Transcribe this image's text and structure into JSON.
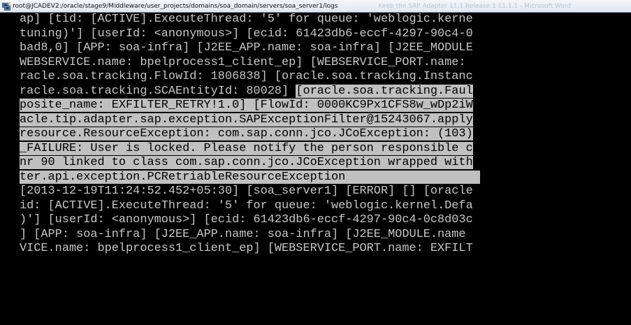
{
  "window": {
    "title": "root@JCADEV2:/oracle/stage9/Middleware/user_projects/domains/soa_domain/servers/soa_server1/logs",
    "background_title": "Keep the SAP Adapter 11.1 Release 1 11.1.1 - Microsoft Word"
  },
  "colors": {
    "terminal_bg": "#000000",
    "terminal_fg": "#c6c6c6",
    "selection_bg": "#c0c0c0",
    "selection_fg": "#000000"
  },
  "terminal": {
    "lines": [
      {
        "pre": "ap] [tid: [ACTIVE].ExecuteThread: '5' for queue: 'weblogic.kerne",
        "sel": "",
        "post": ""
      },
      {
        "pre": "tuning)'] [userId: <anonymous>] [ecid: 61423db6-eccf-4297-90c4-0",
        "sel": "",
        "post": ""
      },
      {
        "pre": "bad8,0] [APP: soa-infra] [J2EE_APP.name: soa-infra] [J2EE_MODULE",
        "sel": "",
        "post": ""
      },
      {
        "pre": "WEBSERVICE.name: bpelprocess1_client_ep] [WEBSERVICE_PORT.name: ",
        "sel": "",
        "post": ""
      },
      {
        "pre": "racle.soa.tracking.FlowId: 1806838] [oracle.soa.tracking.Instanc",
        "sel": "",
        "post": ""
      },
      {
        "pre": "racle.soa.tracking.SCAEntityId: 80028] ",
        "sel": "[oracle.soa.tracking.Faul",
        "post": ""
      },
      {
        "pre": "",
        "sel": "posite_name: EXFILTER_RETRY!1.0] [FlowId: 0000KC9Px1CFS8w_wDp2iW",
        "post": ""
      },
      {
        "pre": "",
        "sel": "acle.tip.adapter.sap.exception.SAPExceptionFilter@15243067.apply",
        "post": ""
      },
      {
        "pre": "",
        "sel": "resource.ResourceException: com.sap.conn.jco.JCoException: (103)",
        "post": ""
      },
      {
        "pre": "",
        "sel": "_FAILURE: User is locked. Please notify the person responsible c",
        "post": ""
      },
      {
        "pre": "",
        "sel": "nr 90 linked to class com.sap.conn.jco.JCoException wrapped with",
        "post": ""
      },
      {
        "pre": "",
        "sel": "ter.api.exception.PCRetriableResourceException                   ",
        "post": ""
      },
      {
        "pre": "[2013-12-19T11:24:52.452+05:30] [soa_server1] [ERROR] [] [oracle",
        "sel": "",
        "post": ""
      },
      {
        "pre": "id: [ACTIVE].ExecuteThread: '5' for queue: 'weblogic.kernel.Defa",
        "sel": "",
        "post": ""
      },
      {
        "pre": ")'] [userId: <anonymous>] [ecid: 61423db6-eccf-4297-90c4-0c8d03c",
        "sel": "",
        "post": ""
      },
      {
        "pre": "] [APP: soa-infra] [J2EE_APP.name: soa-infra] [J2EE_MODULE.name ",
        "sel": "",
        "post": ""
      },
      {
        "pre": "VICE.name: bpelprocess1_client_ep] [WEBSERVICE_PORT.name: EXFILT",
        "sel": "",
        "post": ""
      }
    ]
  },
  "icons": {
    "app": "putty-terminal-icon"
  }
}
